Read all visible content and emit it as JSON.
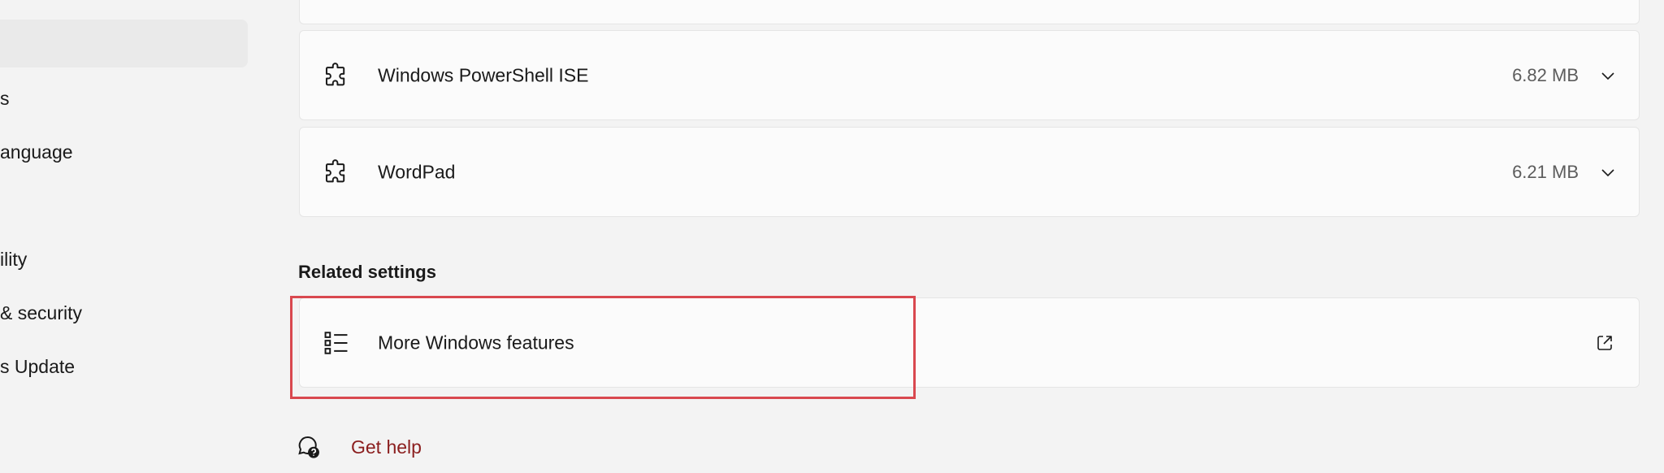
{
  "sidebar": {
    "items": [
      {
        "label": "s"
      },
      {
        "label": "anguage"
      },
      {
        "label": "ility"
      },
      {
        "label": "& security"
      },
      {
        "label": "s Update"
      }
    ]
  },
  "features": [
    {
      "name": "Windows PowerShell ISE",
      "size": "6.82 MB",
      "icon": "puzzle-icon"
    },
    {
      "name": "WordPad",
      "size": "6.21 MB",
      "icon": "puzzle-icon"
    }
  ],
  "related": {
    "heading": "Related settings",
    "items": [
      {
        "label": "More Windows features",
        "icon": "list-icon",
        "action_icon": "external-link-icon"
      }
    ]
  },
  "help": {
    "label": "Get help",
    "icon": "help-icon",
    "color": "#8b1e1e"
  },
  "highlight": {
    "color": "#d9484f"
  }
}
